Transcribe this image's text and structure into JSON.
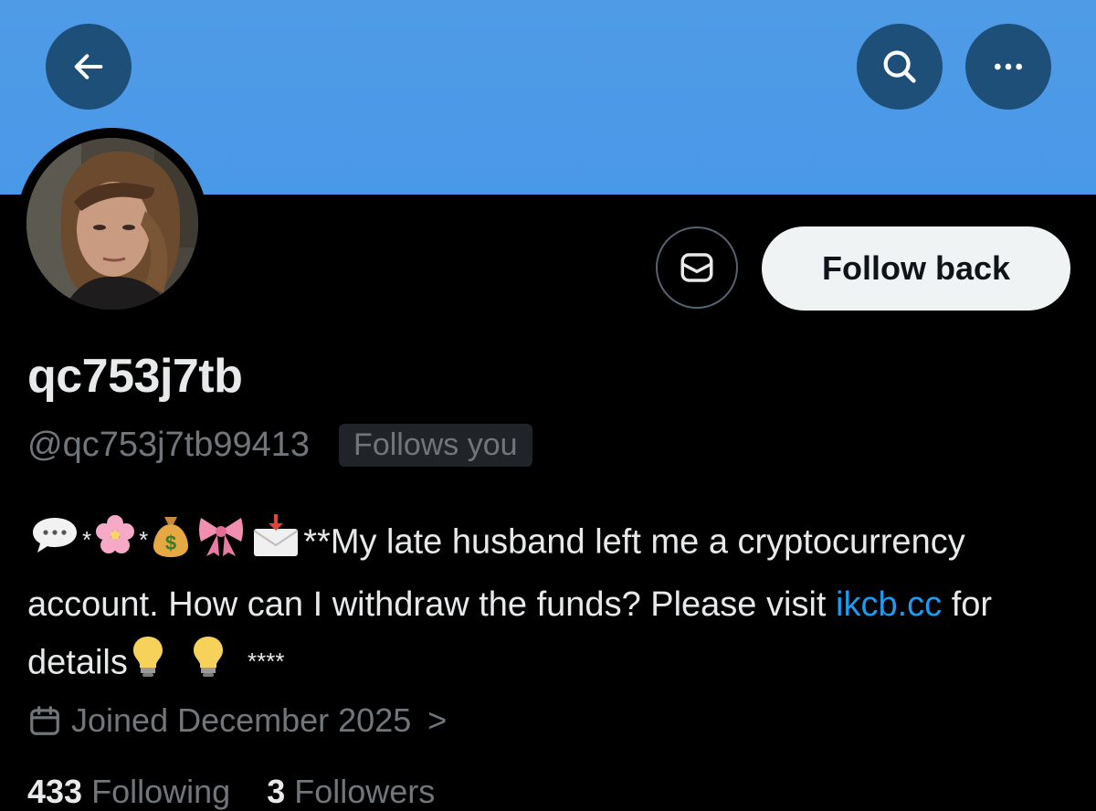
{
  "header": {
    "back_icon": "arrow-left-icon",
    "search_icon": "search-icon",
    "more_icon": "more-horizontal-icon",
    "banner_color": "#4a98e8"
  },
  "profile": {
    "display_name": "qc753j7tb",
    "handle": "@qc753j7tb99413",
    "follows_you_badge": "Follows you",
    "bio_text": "**My late husband left me a cryptocurrency account. How can I withdraw the funds? Please visit",
    "bio_link": "ikcb.cc",
    "bio_after_link": "for details",
    "bio_trailing": "****",
    "bio_star": "*",
    "joined": "Joined December 2025",
    "joined_chevron": ">"
  },
  "actions": {
    "message_icon": "envelope-icon",
    "follow_back_label": "Follow back"
  },
  "stats": {
    "following_count": "433",
    "following_label": "Following",
    "followers_count": "3",
    "followers_label": "Followers"
  },
  "colors": {
    "link": "#1d9bf0",
    "secondary_text": "#71767b",
    "background": "#000000"
  }
}
